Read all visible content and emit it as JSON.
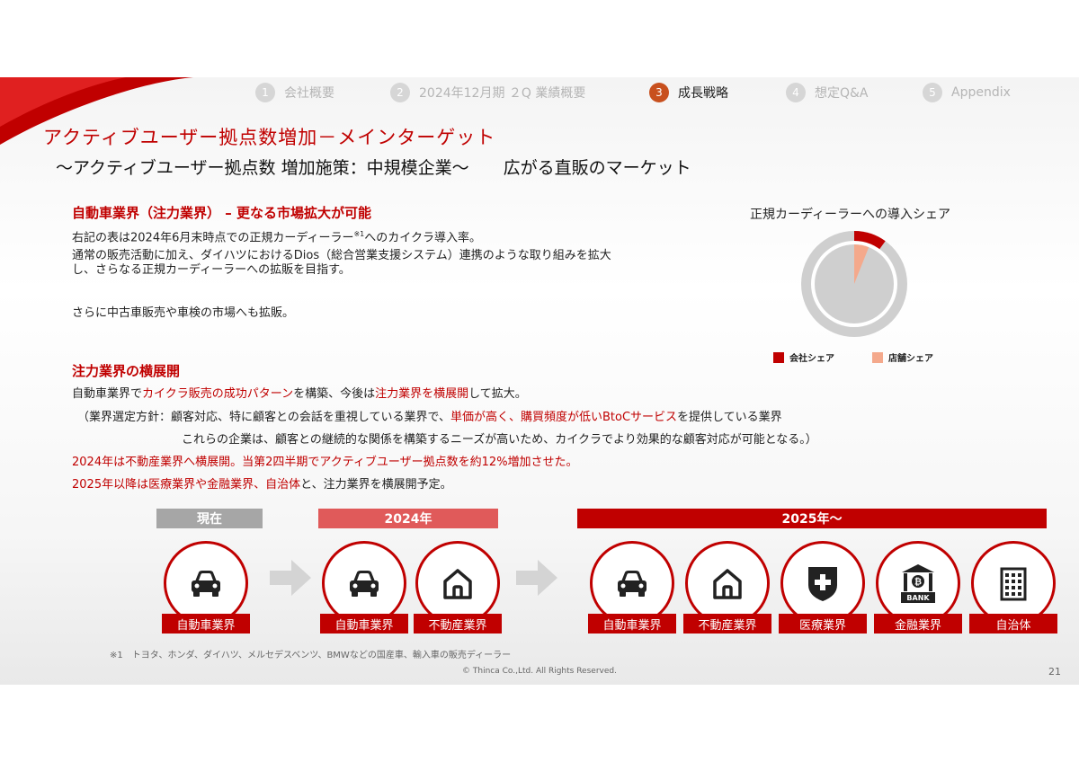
{
  "nav": [
    {
      "num": "1",
      "label": "会社概要"
    },
    {
      "num": "2",
      "label": "2024年12月期 ２Q 業績概要"
    },
    {
      "num": "3",
      "label": "成長戦略"
    },
    {
      "num": "4",
      "label": "想定Q&A"
    },
    {
      "num": "5",
      "label": "Appendix"
    }
  ],
  "title": "アクティブユーザー拠点数増加－メインターゲット",
  "subtitle": "～アクティブユーザー拠点数 増加施策：中規模企業～　　広がる直販のマーケット",
  "section1": {
    "heading": "自動車業界（注力業界） – 更なる市場拡大が可能",
    "line1a": "右記の表は2024年6月末時点での正規カーディーラー",
    "line1sup": "※1",
    "line1b": "へのカイクラ導入率。",
    "line2": "通常の販売活動に加え、ダイハツにおけるDios（総合営業支援システム）連携のような取り組みを拡大",
    "line3": "し、さらなる正規カーディーラーへの拡販を目指す。",
    "line4": "さらに中古車販売や車検の市場へも拡販。"
  },
  "section2": {
    "heading": "注力業界の横展開",
    "l1a": "自動車業界で",
    "l1b": "カイクラ販売の成功パターン",
    "l1c": "を構築、今後は",
    "l1d": "注力業界を横展開",
    "l1e": "して拡大。",
    "l2a": "（業界選定方針：顧客対応、特に顧客との会話を重視している業界で、",
    "l2b": "単価が高く、購買頻度が低いBtoCサービス",
    "l2c": "を提供している業界",
    "l3": "これらの企業は、顧客との継続的な関係を構築するニーズが高いため、カイクラでより効果的な顧客対応が可能となる。）",
    "l4": "2024年は不動産業界へ横展開。当第2四半期でアクティブユーザー拠点数を約12%増加させた。",
    "l5a": "2025年以降は医療業界や金融業界、自治体",
    "l5b": "と、注力業界を横展開予定。"
  },
  "chart_data": {
    "type": "pie",
    "title": "正規カーディーラーへの導入シェア",
    "series": [
      {
        "name": "会社シェア",
        "value": 0.1,
        "color": "#c00000"
      },
      {
        "name": "店舗シェア",
        "value": 0.06,
        "color": "#f4a98c"
      }
    ]
  },
  "timeline": {
    "current_label": "現在",
    "y2024_label": "2024年",
    "y2025_label": "2025年～",
    "industries": [
      {
        "label": "自動車業界",
        "icon": "car-icon"
      },
      {
        "label": "自動車業界",
        "icon": "car-icon"
      },
      {
        "label": "不動産業界",
        "icon": "house-icon"
      },
      {
        "label": "自動車業界",
        "icon": "car-icon"
      },
      {
        "label": "不動産業界",
        "icon": "house-icon"
      },
      {
        "label": "医療業界",
        "icon": "medical-cross-icon"
      },
      {
        "label": "金融業界",
        "icon": "bank-icon"
      },
      {
        "label": "自治体",
        "icon": "building-icon"
      }
    ],
    "bank_text": "BANK"
  },
  "footnote": "※1　トヨタ、ホンダ、ダイハツ、メルセデスベンツ、BMWなどの国産車、輸入車の販売ディーラー",
  "copyright": "© Thinca Co.,Ltd. All Rights Reserved.",
  "page_number": "21",
  "colors": {
    "brand_red": "#c00000",
    "nav_active": "#c8501e",
    "muted_bar": "#e05a5a",
    "gray_bar": "#a6a6a6"
  }
}
